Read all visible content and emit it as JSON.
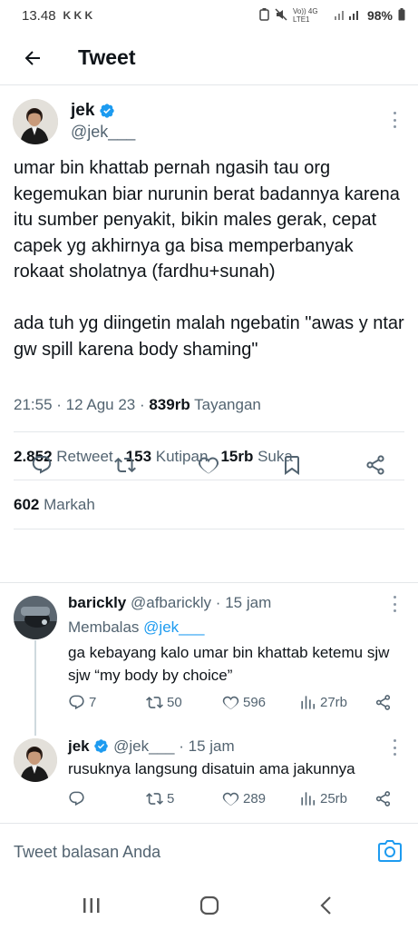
{
  "status_bar": {
    "time": "13.48",
    "notif_icons": "K K K",
    "network": "Vo)) 4G LTE1",
    "battery": "98%"
  },
  "header": {
    "title": "Tweet"
  },
  "tweet": {
    "author_name": "jek",
    "author_handle": "@jek___",
    "paragraphs": [
      "umar bin khattab pernah ngasih tau org kegemukan biar nurunin berat badannya karena itu sumber penyakit, bikin males gerak, cepat capek yg akhirnya ga bisa memperbanyak rokaat sholatnya (fardhu+sunah)",
      "ada tuh yg diingetin malah ngebatin \"awas y ntar gw spill karena body shaming\""
    ],
    "time": "21:55",
    "date": "12 Agu 23",
    "views_count": "839rb",
    "views_label": "Tayangan",
    "retweets_count": "2.852",
    "retweets_label": "Retweet",
    "quotes_count": "153",
    "quotes_label": "Kutipan",
    "likes_count": "15rb",
    "likes_label": "Suka",
    "bookmarks_count": "602",
    "bookmarks_label": "Markah"
  },
  "replies": [
    {
      "name": "barickly",
      "handle": "@afbarickly",
      "time": "15 jam",
      "replying_label": "Membalas",
      "replying_to": "@jek___",
      "text": "ga kebayang kalo umar bin khattab ketemu sjw sjw “my body by choice”",
      "replies": "7",
      "retweets": "50",
      "likes": "596",
      "views": "27rb"
    },
    {
      "name": "jek",
      "handle": "@jek___",
      "time": "15 jam",
      "text": "rusuknya langsung disatuin ama jakunnya",
      "replies": "",
      "retweets": "5",
      "likes": "289",
      "views": "25rb"
    }
  ],
  "compose": {
    "placeholder": "Tweet balasan Anda"
  },
  "colors": {
    "accent": "#1d9bf0",
    "muted": "#536471",
    "text": "#0f1419",
    "divider": "#e4e7ea"
  }
}
